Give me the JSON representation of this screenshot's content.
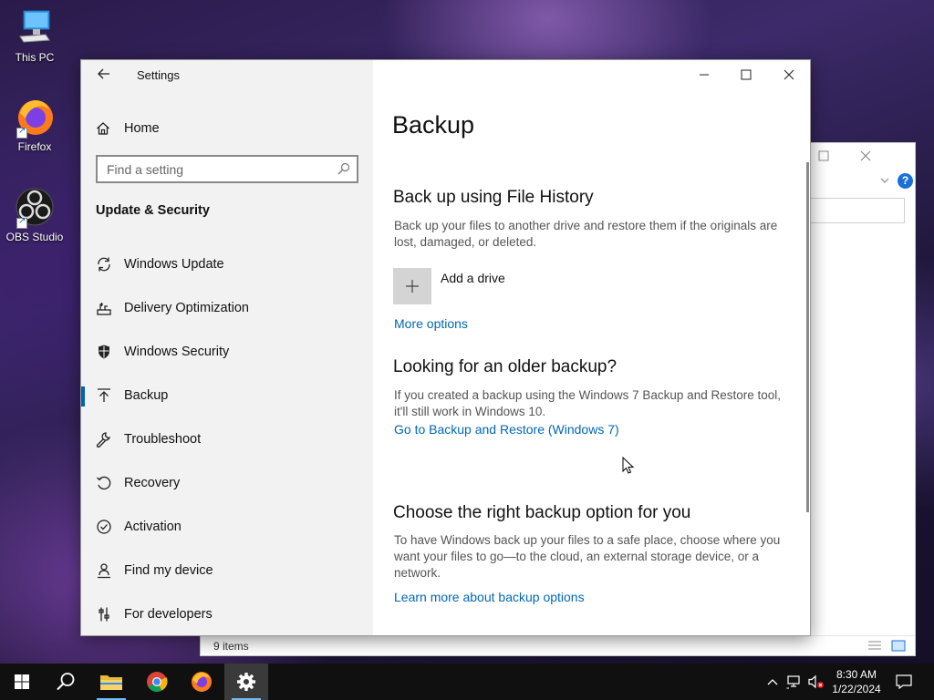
{
  "desktop": {
    "icons": [
      {
        "label": "This PC"
      },
      {
        "label": "Firefox"
      },
      {
        "label": "OBS Studio"
      }
    ]
  },
  "background_window": {
    "status": "9 items"
  },
  "settings": {
    "app_title": "Settings",
    "nav": {
      "home_label": "Home",
      "search_placeholder": "Find a setting",
      "section_title": "Update & Security",
      "items": [
        {
          "label": "Windows Update",
          "icon": "refresh-icon"
        },
        {
          "label": "Delivery Optimization",
          "icon": "delivery-optimization-icon"
        },
        {
          "label": "Windows Security",
          "icon": "shield-icon"
        },
        {
          "label": "Backup",
          "icon": "backup-arrow-icon",
          "selected": true
        },
        {
          "label": "Troubleshoot",
          "icon": "wrench-icon"
        },
        {
          "label": "Recovery",
          "icon": "recovery-icon"
        },
        {
          "label": "Activation",
          "icon": "check-circle-icon"
        },
        {
          "label": "Find my device",
          "icon": "person-pin-icon"
        },
        {
          "label": "For developers",
          "icon": "developer-tools-icon"
        }
      ]
    },
    "content": {
      "page_title": "Backup",
      "file_history": {
        "heading": "Back up using File History",
        "description": "Back up your files to another drive and restore them if the originals are lost, damaged, or deleted.",
        "add_drive_label": "Add a drive",
        "more_options_link": "More options"
      },
      "older_backup": {
        "heading": "Looking for an older backup?",
        "description": "If you created a backup using the Windows 7 Backup and Restore tool, it'll still work in Windows 10.",
        "link": "Go to Backup and Restore (Windows 7)"
      },
      "choose_option": {
        "heading": "Choose the right backup option for you",
        "description": "To have Windows back up your files to a safe place, choose where you want your files to go—to the cloud, an external storage device, or a network.",
        "link": "Learn more about backup options"
      }
    },
    "accent_color": "#0063b1",
    "link_color": "#0067b8"
  },
  "taskbar": {
    "time": "8:30 AM",
    "date": "1/22/2024"
  }
}
